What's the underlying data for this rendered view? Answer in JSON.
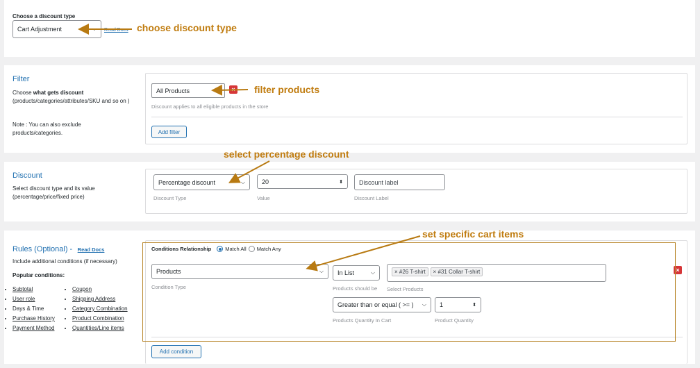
{
  "discount_type_section": {
    "label": "Choose a discount type",
    "selected": "Cart Adjustment",
    "read_docs": "Read Docs"
  },
  "filter_section": {
    "title": "Filter",
    "desc_prefix": "Choose ",
    "desc_bold": "what gets discount",
    "desc_rest": "(products/categories/attributes/SKU and so on )",
    "note": "Note : You can also exclude products/categories.",
    "selected": "All Products",
    "hint": "Discount applies to all eligible products in the store",
    "add_filter": "Add filter"
  },
  "discount_section": {
    "title": "Discount",
    "desc": "Select discount type and its value (percentage/price/fixed price)",
    "type_value": "Percentage discount",
    "type_hint": "Discount Type",
    "value": "20",
    "value_hint": "Value",
    "label_placeholder": "Discount label",
    "label_hint": "Discount Label"
  },
  "rules_section": {
    "title": "Rules (Optional) -",
    "read_docs": "Read Docs",
    "desc": "Include additional conditions (if necessary)",
    "popular_title": "Popular conditions:",
    "popular_left": [
      "Subtotal",
      "User role",
      "Days & Time",
      "Purchase History",
      "Payment Method"
    ],
    "popular_right": [
      "Coupon",
      "Shipping Address",
      "Category Combination",
      "Product Combination",
      "Quantities/Line items"
    ],
    "conditions_relationship": "Conditions Relationship",
    "match_all": "Match All",
    "match_any": "Match Any",
    "condition_type": "Products",
    "condition_type_hint": "Condition Type",
    "in_list": "In List",
    "in_list_hint": "Products should be",
    "select_products_hint": "Select Products",
    "tags": [
      "× #26 T-shirt",
      "× #31 Collar T-shirt"
    ],
    "qty_op": "Greater than or equal ( >= )",
    "qty_op_hint": "Products Quantity In Cart",
    "qty_value": "1",
    "qty_value_hint": "Product Quantity",
    "add_condition": "Add condition"
  },
  "annotations": {
    "a1": "choose discount type",
    "a2": "filter products",
    "a3": "select percentage discount",
    "a4": "set specific cart items"
  },
  "colors": {
    "accent": "#2271b1",
    "annotation": "#c07c0f",
    "danger": "#d63638"
  }
}
